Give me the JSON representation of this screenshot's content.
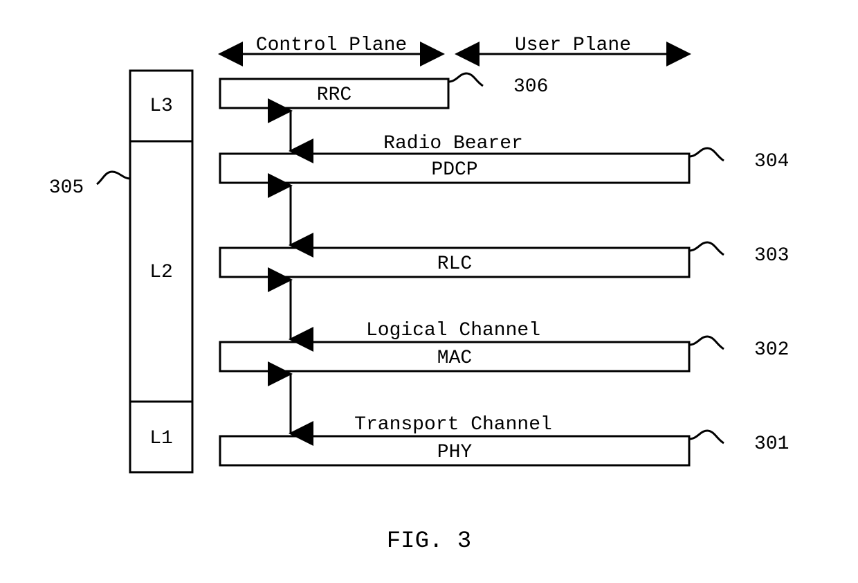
{
  "figure_label": "FIG. 3",
  "planes": {
    "control": "Control Plane",
    "user": "User Plane"
  },
  "layer_sidebar": {
    "l3": "L3",
    "l2": "L2",
    "l1": "L1"
  },
  "layer_sidebar_ref": "305",
  "protocol_boxes": {
    "rrc": {
      "label": "RRC",
      "ref": "306",
      "interface_below": "Radio Bearer"
    },
    "pdcp": {
      "label": "PDCP",
      "ref": "304",
      "interface_below": ""
    },
    "rlc": {
      "label": "RLC",
      "ref": "303",
      "interface_below": "Logical Channel"
    },
    "mac": {
      "label": "MAC",
      "ref": "302",
      "interface_below": "Transport Channel"
    },
    "phy": {
      "label": "PHY",
      "ref": "301",
      "interface_below": ""
    }
  }
}
